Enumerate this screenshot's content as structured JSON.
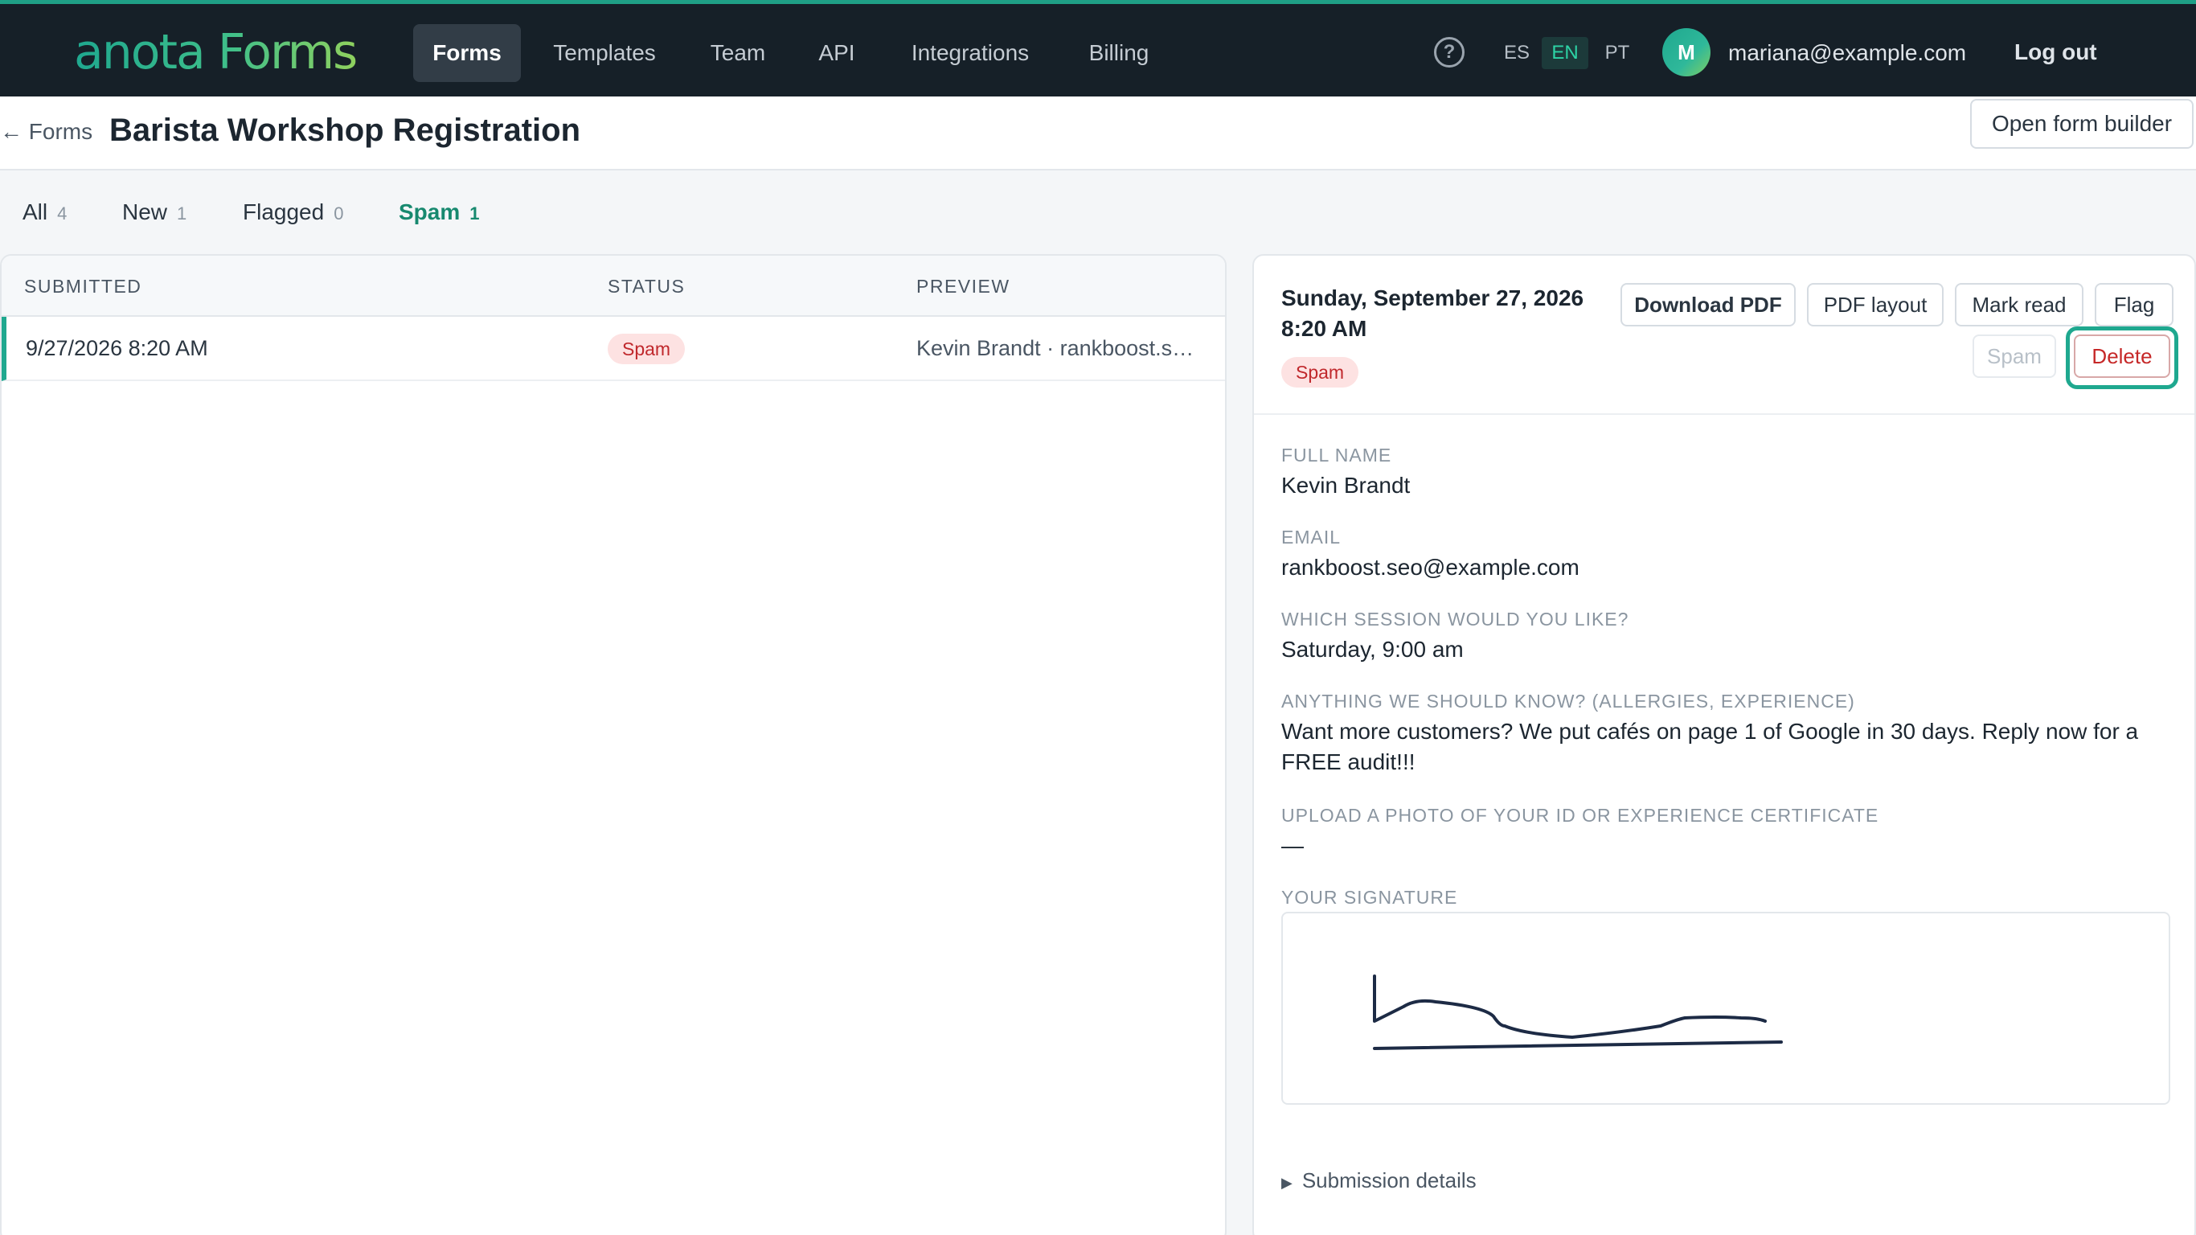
{
  "app": {
    "brand": "anota Forms",
    "nav": [
      {
        "label": "Forms",
        "active": true
      },
      {
        "label": "Templates",
        "active": false
      },
      {
        "label": "Team",
        "active": false
      },
      {
        "label": "API",
        "active": false
      },
      {
        "label": "Integrations",
        "active": false
      },
      {
        "label": "Billing",
        "active": false
      }
    ],
    "help_icon": "question-circle-icon",
    "languages": [
      {
        "code": "ES",
        "active": false
      },
      {
        "code": "EN",
        "active": true
      },
      {
        "code": "PT",
        "active": false
      }
    ],
    "user": {
      "initial": "M",
      "email": "mariana@example.com"
    },
    "logout_label": "Log out"
  },
  "page": {
    "back_label": "← Forms",
    "title": "Barista Workshop Registration",
    "open_builder_label": "Open form builder"
  },
  "filters": [
    {
      "label": "All",
      "count": "4",
      "active": false
    },
    {
      "label": "New",
      "count": "1",
      "active": false
    },
    {
      "label": "Flagged",
      "count": "0",
      "active": false
    },
    {
      "label": "Spam",
      "count": "1",
      "active": true
    }
  ],
  "list": {
    "columns": [
      "SUBMITTED",
      "STATUS",
      "PREVIEW"
    ],
    "rows": [
      {
        "submitted": "9/27/2026 8:20 AM",
        "status": "Spam",
        "preview": "Kevin Brandt · rankboost.seo@example.com",
        "selected": true
      }
    ]
  },
  "detail": {
    "date_line1": "Sunday, September 27, 2026",
    "date_line2": "8:20 AM",
    "status": "Spam",
    "actions": {
      "download_pdf": "Download PDF",
      "pdf_layout": "PDF layout",
      "mark_read": "Mark read",
      "flag": "Flag",
      "spam": "Spam",
      "delete": "Delete"
    },
    "fields": [
      {
        "label": "FULL NAME",
        "value": "Kevin Brandt"
      },
      {
        "label": "EMAIL",
        "value": "rankboost.seo@example.com"
      },
      {
        "label": "WHICH SESSION WOULD YOU LIKE?",
        "value": "Saturday, 9:00 am"
      },
      {
        "label": "ANYTHING WE SHOULD KNOW? (ALLERGIES, EXPERIENCE)",
        "value": "Want more customers? We put cafés on page 1 of Google in 30 days. Reply now for a FREE audit!!!"
      },
      {
        "label": "UPLOAD A PHOTO OF YOUR ID OR EXPERIENCE CERTIFICATE",
        "value": "—"
      },
      {
        "label": "YOUR SIGNATURE",
        "value": ""
      }
    ],
    "submission_details_label": "Submission details"
  },
  "colors": {
    "accent": "#1fa88f",
    "nav_bg": "#162028",
    "danger": "#c62828",
    "spam_badge_bg": "#fde2e2"
  }
}
